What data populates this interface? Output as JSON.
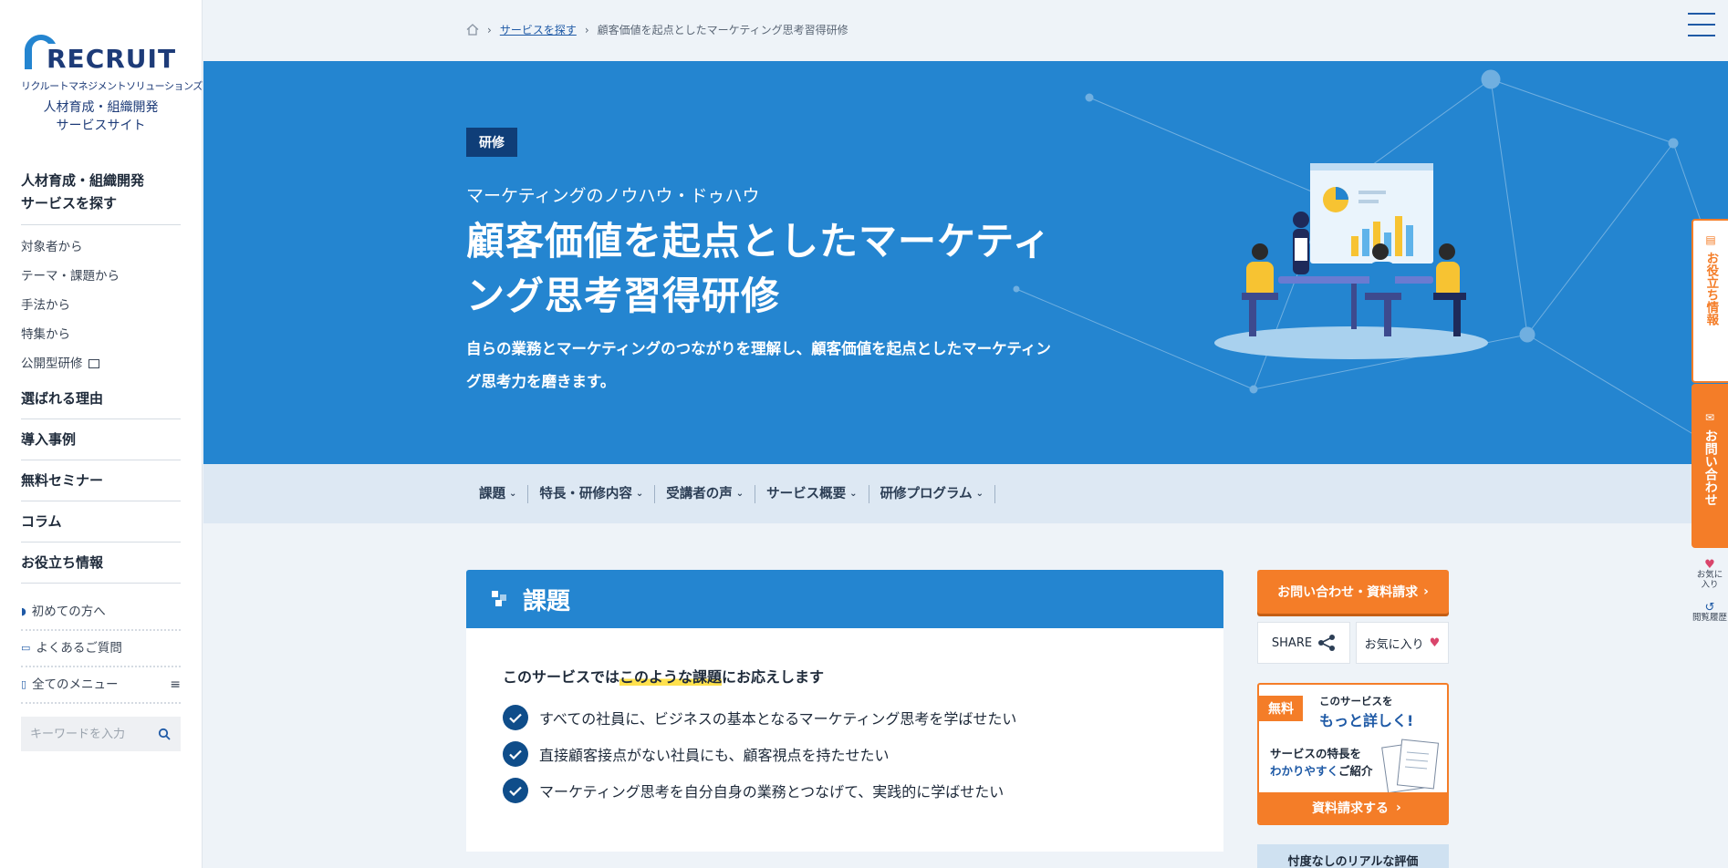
{
  "brand": {
    "logo_text": "RECRUIT",
    "logo_sub": "リクルートマネジメントソリューションズ",
    "site_name_1": "人材育成・組織開発",
    "site_name_2": "サービスサイト"
  },
  "sidebar": {
    "heading_1": "人材育成・組織開発",
    "heading_2": "サービスを探す",
    "sub_items": [
      "対象者から",
      "テーマ・課題から",
      "手法から",
      "特集から",
      "公開型研修"
    ],
    "main_items": [
      "選ばれる理由",
      "導入事例",
      "無料セミナー",
      "コラム",
      "お役立ち情報"
    ],
    "util_items": [
      "初めての方へ",
      "よくあるご質問",
      "全てのメニュー"
    ],
    "search_placeholder": "キーワードを入力"
  },
  "breadcrumb": {
    "link": "サービスを探す",
    "current": "顧客価値を起点としたマーケティング思考習得研修"
  },
  "hero": {
    "badge": "研修",
    "subtitle": "マーケティングのノウハウ・ドゥハウ",
    "title_line1": "顧客価値を起点としたマーケティ",
    "title_line2": "ング思考習得研修",
    "desc_line1": "自らの業務とマーケティングのつながりを理解し、顧客価値を起点としたマーケティン",
    "desc_line2": "グ思考力を磨きます。"
  },
  "tabs": [
    "課題",
    "特長・研修内容",
    "受講者の声",
    "サービス概要",
    "研修プログラム"
  ],
  "section": {
    "title": "課題",
    "lead_pre": "このサービスでは",
    "lead_hl": "このような課題",
    "lead_post": "にお応えします",
    "issues": [
      "すべての社員に、ビジネスの基本となるマーケティング思考を学ばせたい",
      "直接顧客接点がない社員にも、顧客視点を持たせたい",
      "マーケティング思考を自分自身の業務とつなげて、実践的に学ばせたい"
    ]
  },
  "right": {
    "cta": "お問い合わせ・資料請求",
    "share": "SHARE",
    "favorite": "お気に入り",
    "banner_free": "無料",
    "banner_t1": "このサービスを",
    "banner_t2": "もっと詳しく!",
    "banner_t3a": "サービスの特長を",
    "banner_t3b": "わかりやすく",
    "banner_t3c": "ご紹介",
    "banner_btn": "資料請求する",
    "review": "忖度なしのリアルな評価"
  },
  "float": {
    "useful": "お役立ち情報",
    "contact": "お問い合わせ",
    "fav": "お気に入り",
    "history": "閲覧履歴"
  },
  "colors": {
    "primary": "#2485d0",
    "navy": "#0f3e78",
    "accent": "#f47d28"
  }
}
